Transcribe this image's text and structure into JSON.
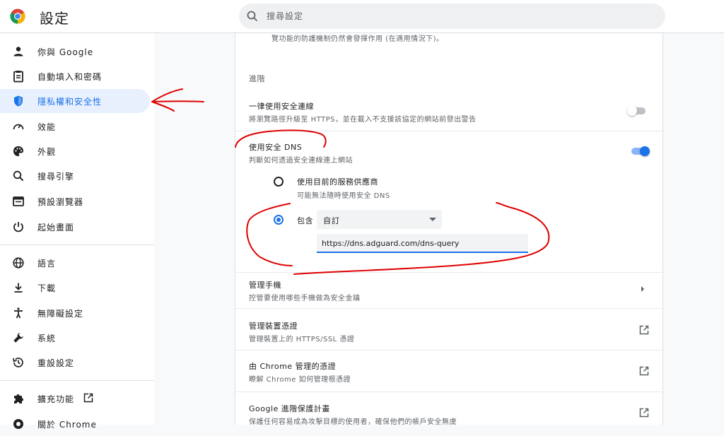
{
  "header": {
    "title": "設定",
    "search_placeholder": "搜尋設定"
  },
  "sidebar": {
    "items": [
      {
        "label": "你與 Google",
        "icon": "person-icon"
      },
      {
        "label": "自動填入和密碼",
        "icon": "clipboard-icon"
      },
      {
        "label": "隱私權和安全性",
        "icon": "shield-icon",
        "active": true
      },
      {
        "label": "效能",
        "icon": "speedometer-icon"
      },
      {
        "label": "外觀",
        "icon": "palette-icon"
      },
      {
        "label": "搜尋引擎",
        "icon": "search-icon"
      },
      {
        "label": "預設瀏覽器",
        "icon": "browser-icon"
      },
      {
        "label": "起始畫面",
        "icon": "power-icon"
      },
      {
        "label": "語言",
        "icon": "globe-icon"
      },
      {
        "label": "下載",
        "icon": "download-icon"
      },
      {
        "label": "無障礙設定",
        "icon": "accessibility-icon"
      },
      {
        "label": "系統",
        "icon": "wrench-icon"
      },
      {
        "label": "重設設定",
        "icon": "history-icon"
      },
      {
        "label": "擴充功能",
        "icon": "puzzle-icon"
      },
      {
        "label": "關於 Chrome",
        "icon": "chrome-icon"
      }
    ]
  },
  "main": {
    "top_partial": "覽功能的防護機制仍然會發揮作用 (在適用情況下)。",
    "advanced_title": "進階",
    "https_title": "一律使用安全連線",
    "https_desc": "將瀏覽路徑升級至 HTTPS，並在載入不支援該協定的網站前發出警告",
    "https_toggle": false,
    "dns_title": "使用安全 DNS",
    "dns_desc": "判斷如何透過安全連線連上網站",
    "dns_toggle": true,
    "radio_current_title": "使用目前的服務供應商",
    "radio_current_desc": "可能無法隨時使用安全 DNS",
    "radio_current_selected": false,
    "radio_custom_label": "包含",
    "radio_custom_selected": true,
    "provider_select_value": "自訂",
    "dns_url_value": "https://dns.adguard.com/dns-query",
    "manage_phones_title": "管理手機",
    "manage_phones_desc": "控管要使用哪些手機做為安全金鑰",
    "manage_certs_title": "管理裝置憑證",
    "manage_certs_desc": "管理裝置上的 HTTPS/SSL 憑證",
    "chrome_certs_title": "由 Chrome 管理的憑證",
    "chrome_certs_desc": "瞭解 Chrome 如何管理根憑證",
    "adv_protection_title": "Google 進階保護計畫",
    "adv_protection_desc": "保護任何容易成為攻擊目標的使用者，確保他們的帳戶安全無虞"
  },
  "colors": {
    "accent": "#1a73e8",
    "annotation": "#e00000"
  }
}
